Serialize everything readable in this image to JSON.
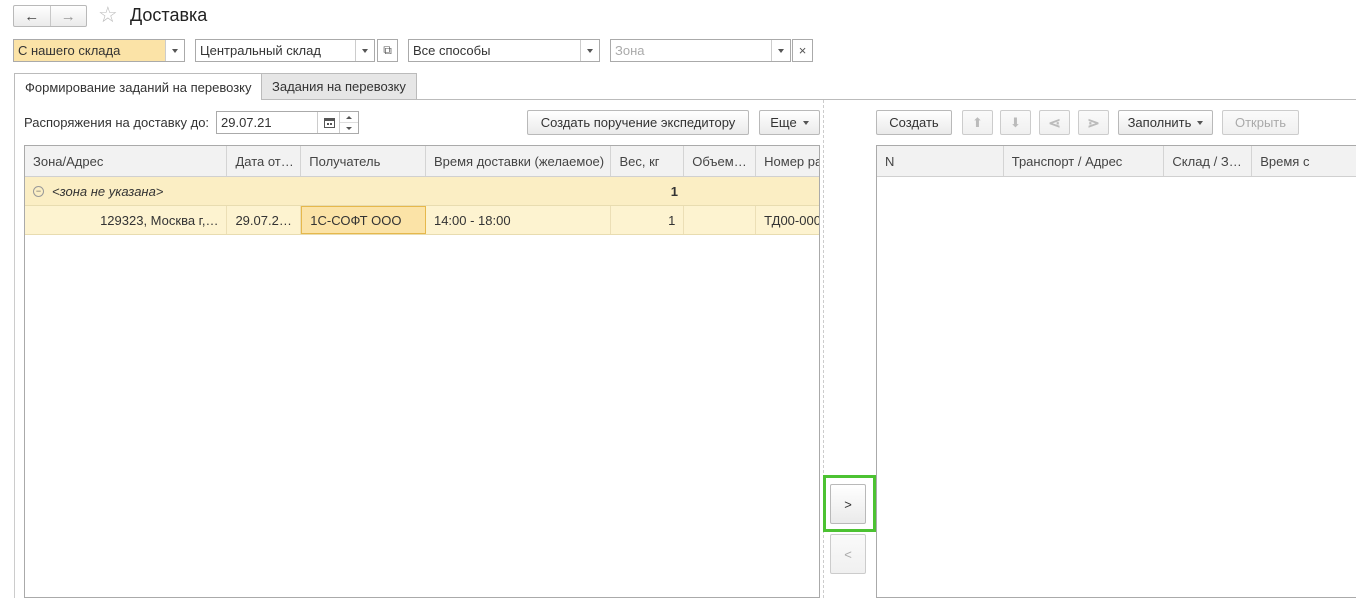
{
  "header": {
    "back_icon": "←",
    "forward_icon": "→",
    "favorite_icon": "☆",
    "title": "Доставка"
  },
  "filters": {
    "source": "С нашего склада",
    "warehouse": "Центральный склад",
    "method": "Все способы",
    "zone_placeholder": "Зона",
    "clear_icon": "×",
    "open_icon": "⧉"
  },
  "tabs": [
    {
      "label": "Формирование заданий на перевозку"
    },
    {
      "label": "Задания на перевозку"
    }
  ],
  "left": {
    "date_label": "Распоряжения на доставку до:",
    "date_value": "29.07.21",
    "create_order_btn": "Создать поручение экспедитору",
    "more_btn": "Еще",
    "columns": [
      "Зона/Адрес",
      "Дата от…",
      "Получатель",
      "Время доставки (желаемое)",
      "Вес, кг",
      "Объем…",
      "Номер ра"
    ],
    "group_row": {
      "label": "<зона не указана>",
      "weight": "1"
    },
    "data_row": {
      "address": "129323, Москва г,…",
      "date": "29.07.2…",
      "recipient": "1С-СОФТ ООО",
      "time": "14:00 - 18:00",
      "weight": "1",
      "volume": "",
      "number": "ТД00-000"
    }
  },
  "middle": {
    "add_btn": ">",
    "remove_btn": "<"
  },
  "right": {
    "create_btn": "Создать",
    "up_icon": "⬆",
    "down_icon": "⬇",
    "split_icon": "⋖",
    "merge_icon": "⋗",
    "fill_btn": "Заполнить",
    "open_btn": "Открыть",
    "columns": [
      "N",
      "Транспорт / Адрес",
      "Склад / З…",
      "Время с"
    ]
  },
  "colors": {
    "highlight": "#fbe3a7",
    "row_bg": "#fdf3d0",
    "group_bg": "#fbeec4",
    "focus_border": "#4cc232"
  }
}
